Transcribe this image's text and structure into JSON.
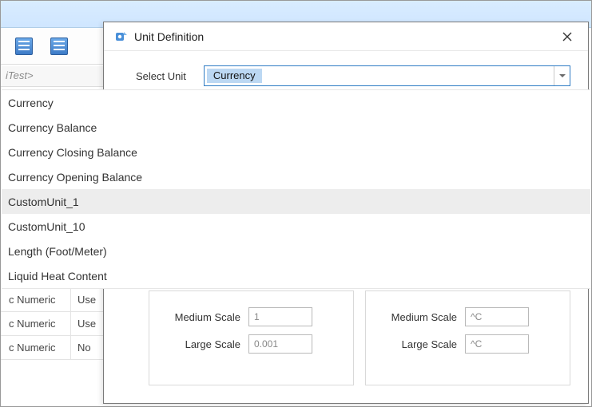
{
  "bg": {
    "crumb": "iTest>",
    "rows": [
      {
        "type": "c Numeric",
        "scope": "Use"
      },
      {
        "type": "c Numeric",
        "scope": "Use"
      },
      {
        "type": "c Numeric",
        "scope": "No"
      }
    ]
  },
  "modal": {
    "title": "Unit Definition",
    "select_label": "Select Unit",
    "selected_value": "Currency",
    "options": [
      "Currency",
      "Currency Balance",
      "Currency Closing Balance",
      "Currency Opening Balance",
      "CustomUnit_1",
      "CustomUnit_10",
      "Length (Foot/Meter)",
      "Liquid Heat Content"
    ],
    "highlighted_index": 4,
    "left_panel": {
      "medium_label": "Medium Scale",
      "medium_value": "1",
      "large_label": "Large Scale",
      "large_value": "0.001"
    },
    "right_panel": {
      "medium_label": "Medium Scale",
      "medium_value": "^C",
      "large_label": "Large Scale",
      "large_value": "^C"
    }
  }
}
